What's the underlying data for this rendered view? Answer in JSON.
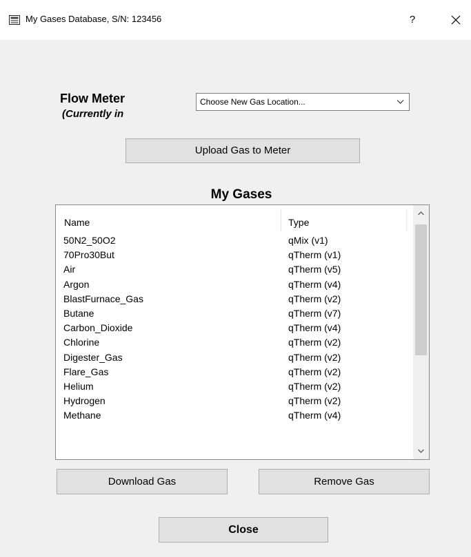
{
  "window": {
    "title": "My Gases Database, S/N: 123456",
    "help_label": "?"
  },
  "flow_meter": {
    "title": "Flow Meter",
    "subtitle": "(Currently in"
  },
  "location_select": {
    "value": "Choose New Gas Location..."
  },
  "buttons": {
    "upload": "Upload Gas to Meter",
    "download": "Download Gas",
    "remove": "Remove Gas",
    "close": "Close"
  },
  "gases": {
    "heading": "My Gases",
    "columns": {
      "name": "Name",
      "type": "Type"
    },
    "rows": [
      {
        "name": "50N2_50O2",
        "type": "qMix (v1)"
      },
      {
        "name": "70Pro30But",
        "type": "qTherm (v1)"
      },
      {
        "name": "Air",
        "type": "qTherm (v5)"
      },
      {
        "name": "Argon",
        "type": "qTherm (v4)"
      },
      {
        "name": "BlastFurnace_Gas",
        "type": "qTherm (v2)"
      },
      {
        "name": "Butane",
        "type": "qTherm (v7)"
      },
      {
        "name": "Carbon_Dioxide",
        "type": "qTherm (v4)"
      },
      {
        "name": "Chlorine",
        "type": "qTherm (v2)"
      },
      {
        "name": "Digester_Gas",
        "type": "qTherm (v2)"
      },
      {
        "name": "Flare_Gas",
        "type": "qTherm (v2)"
      },
      {
        "name": "Helium",
        "type": "qTherm (v2)"
      },
      {
        "name": "Hydrogen",
        "type": "qTherm (v2)"
      },
      {
        "name": "Methane",
        "type": "qTherm (v4)"
      }
    ]
  },
  "icons": {
    "app": "database-app-icon",
    "close": "close-icon",
    "dropdown": "chevron-down-icon",
    "scroll_up": "scroll-up-arrow-icon",
    "scroll_down": "scroll-down-arrow-icon"
  }
}
